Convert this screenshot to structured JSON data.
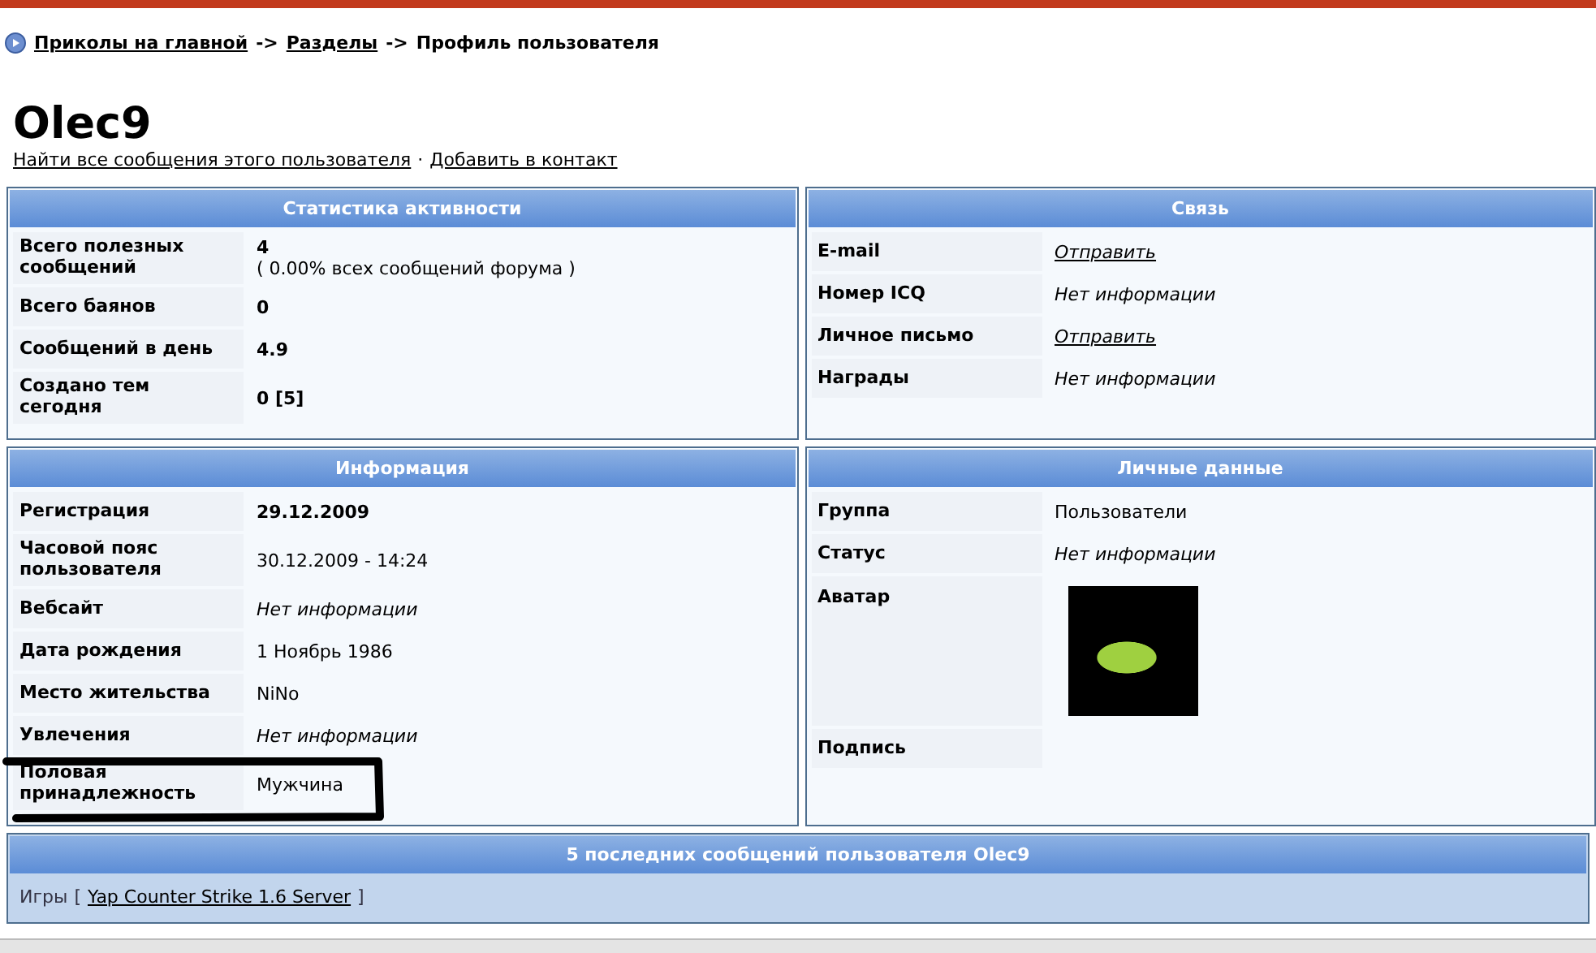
{
  "breadcrumb": {
    "items": [
      {
        "text": "Приколы на главной",
        "kind": "link"
      },
      {
        "text": "Разделы",
        "kind": "link"
      },
      {
        "text": "Профиль пользователя",
        "kind": "current"
      }
    ],
    "separator": "->"
  },
  "profile": {
    "name": "Olec9",
    "actions": [
      "Найти все сообщения этого пользователя",
      "Добавить в контакт"
    ],
    "action_separator": "·"
  },
  "panels": [
    {
      "title": "Статистика активности",
      "rows": [
        {
          "label": "Всего полезных сообщений",
          "value": "4",
          "note": "( 0.00% всех сообщений форума )",
          "kind": "bold"
        },
        {
          "label": "Всего баянов",
          "value": "0",
          "kind": "bold"
        },
        {
          "label": "Сообщений в день",
          "value": "4.9",
          "kind": "bold"
        },
        {
          "label": "Создано тем сегодня",
          "value": "0 [5]",
          "kind": "bold"
        }
      ]
    },
    {
      "title": "Связь",
      "rows": [
        {
          "label": "E-mail",
          "value": "Отправить",
          "kind": "link"
        },
        {
          "label": "Номер ICQ",
          "value": "Нет информации",
          "kind": "italic"
        },
        {
          "label": "Личное письмо",
          "value": "Отправить",
          "kind": "link"
        },
        {
          "label": "Награды",
          "value": "Нет информации",
          "kind": "italic"
        }
      ]
    },
    {
      "title": "Информация",
      "rows": [
        {
          "label": "Регистрация",
          "value": "29.12.2009",
          "kind": "bold"
        },
        {
          "label": "Часовой пояс пользователя",
          "value": "30.12.2009 - 14:24",
          "kind": "text"
        },
        {
          "label": "Вебсайт",
          "value": "Нет информации",
          "kind": "italic"
        },
        {
          "label": "Дата рождения",
          "value": "1 Ноябрь 1986",
          "kind": "text"
        },
        {
          "label": "Место жительства",
          "value": "NiNo",
          "kind": "text"
        },
        {
          "label": "Увлечения",
          "value": "Нет информации",
          "kind": "italic"
        },
        {
          "label": "Половая принадлежность",
          "value": "Мужчина",
          "kind": "text"
        }
      ]
    },
    {
      "title": "Личные данные",
      "rows": [
        {
          "label": "Группа",
          "value": "Пользователи",
          "kind": "text"
        },
        {
          "label": "Статус",
          "value": "Нет информации",
          "kind": "italic"
        },
        {
          "label": "Аватар",
          "kind": "avatar"
        },
        {
          "label": "Подпись",
          "kind": "empty"
        }
      ]
    }
  ],
  "recent": {
    "title": "5 последних сообщений пользователя Olec9",
    "posts": [
      {
        "forum": "Игры",
        "open": "[",
        "topic": "Yap Counter Strike 1.6 Server",
        "close": "]"
      }
    ]
  }
}
